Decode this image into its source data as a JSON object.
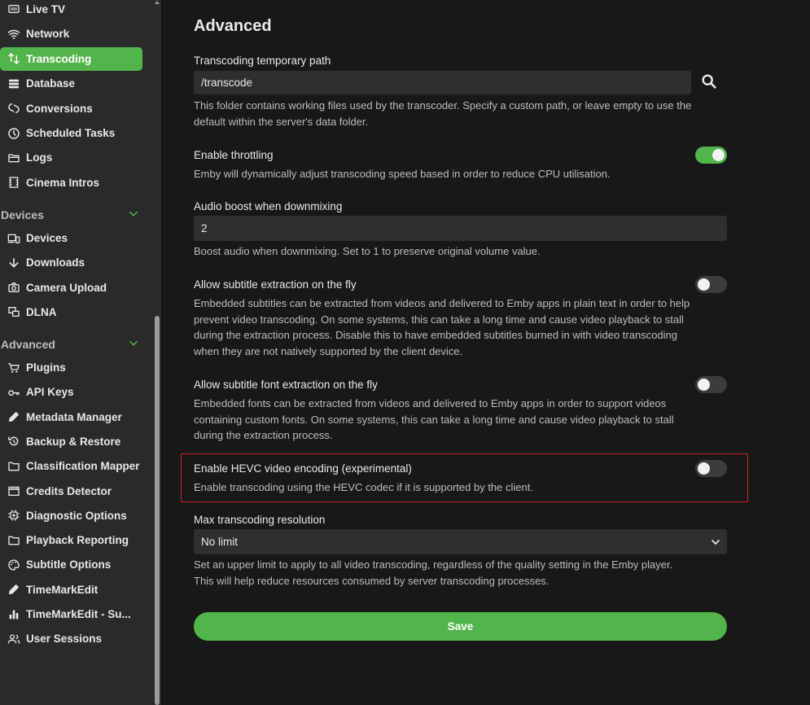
{
  "sidebar": {
    "items_top": [
      {
        "label": "Live TV",
        "icon": "tv-icon"
      },
      {
        "label": "Network",
        "icon": "wifi-icon"
      },
      {
        "label": "Transcoding",
        "icon": "transcode-icon",
        "active": true
      },
      {
        "label": "Database",
        "icon": "database-icon"
      },
      {
        "label": "Conversions",
        "icon": "conversions-icon"
      },
      {
        "label": "Scheduled Tasks",
        "icon": "clock-icon"
      },
      {
        "label": "Logs",
        "icon": "folder-open-icon"
      },
      {
        "label": "Cinema Intros",
        "icon": "film-icon"
      }
    ],
    "section_devices": "Devices",
    "items_devices": [
      {
        "label": "Devices",
        "icon": "devices-icon"
      },
      {
        "label": "Downloads",
        "icon": "download-arrow-icon"
      },
      {
        "label": "Camera Upload",
        "icon": "camera-icon"
      },
      {
        "label": "DLNA",
        "icon": "dlna-icon"
      }
    ],
    "section_advanced": "Advanced",
    "items_advanced": [
      {
        "label": "Plugins",
        "icon": "cart-icon"
      },
      {
        "label": "API Keys",
        "icon": "key-icon"
      },
      {
        "label": "Metadata Manager",
        "icon": "pencil-icon"
      },
      {
        "label": "Backup & Restore",
        "icon": "restore-icon"
      },
      {
        "label": "Classification Mapper",
        "icon": "folder-icon"
      },
      {
        "label": "Credits Detector",
        "icon": "clapper-icon"
      },
      {
        "label": "Diagnostic Options",
        "icon": "chip-icon"
      },
      {
        "label": "Playback Reporting",
        "icon": "folder-icon"
      },
      {
        "label": "Subtitle Options",
        "icon": "palette-icon"
      },
      {
        "label": "TimeMarkEdit",
        "icon": "pencil-icon"
      },
      {
        "label": "TimeMarkEdit - Su...",
        "icon": "bar-chart-icon"
      },
      {
        "label": "User Sessions",
        "icon": "users-icon"
      }
    ]
  },
  "main": {
    "title": "Advanced",
    "temp_path": {
      "label": "Transcoding temporary path",
      "value": "/transcode",
      "desc_line1": "This folder contains working files used by the transcoder. Specify a custom path, or leave empty to use the",
      "desc_line2": "default within the server's data folder."
    },
    "throttling": {
      "label": "Enable throttling",
      "desc": "Emby will dynamically adjust transcoding speed based in order to reduce CPU utilisation.",
      "on": true
    },
    "audio_boost": {
      "label": "Audio boost when downmixing",
      "value": "2",
      "desc": "Boost audio when downmixing. Set to 1 to preserve original volume value."
    },
    "subtitle_extraction": {
      "label": "Allow subtitle extraction on the fly",
      "desc_line1": "Embedded subtitles can be extracted from videos and delivered to Emby apps in plain text in order to help",
      "desc_line2": "prevent video transcoding. On some systems, this can take a long time and cause video playback to stall",
      "desc_line3": "during the extraction process. Disable this to have embedded subtitles burned in with video transcoding",
      "desc_line4": "when they are not natively supported by the client device.",
      "on": false
    },
    "font_extraction": {
      "label": "Allow subtitle font extraction on the fly",
      "desc_line1": "Embedded fonts can be extracted from videos and delivered to Emby apps in order to support videos",
      "desc_line2": "containing custom fonts. On some systems, this can take a long time and cause video playback to stall",
      "desc_line3": "during the extraction process.",
      "on": false
    },
    "hevc": {
      "label": "Enable HEVC video encoding (experimental)",
      "desc": "Enable transcoding using the HEVC codec if it is supported by the client.",
      "on": false
    },
    "max_resolution": {
      "label": "Max transcoding resolution",
      "value": "No limit",
      "desc_line1": "Set an upper limit to apply to all video transcoding, regardless of the quality setting in the Emby player.",
      "desc_line2": "This will help reduce resources consumed by server transcoding processes."
    },
    "save_label": "Save"
  },
  "colors": {
    "accent": "#52b54b",
    "highlight_border": "#c3272b",
    "background": "#181818",
    "sidebar": "#2a2a2a"
  }
}
